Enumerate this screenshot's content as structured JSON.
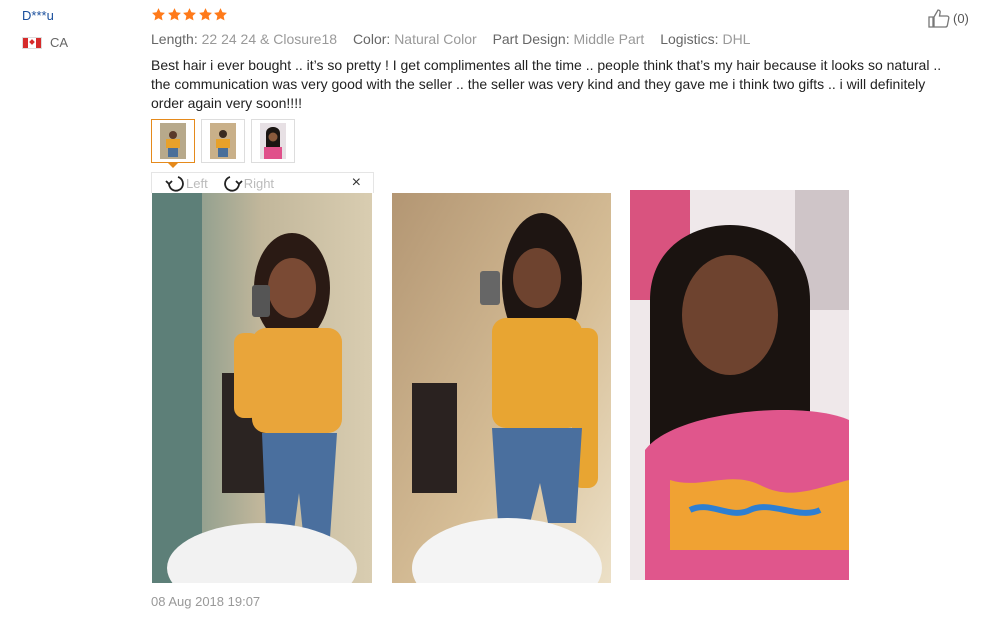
{
  "review": {
    "user": "D***u",
    "country": "CA",
    "rating": 5,
    "attributes": [
      {
        "key": "Length:",
        "value": "22 24 24 & Closure18"
      },
      {
        "key": "Color:",
        "value": "Natural Color"
      },
      {
        "key": "Part Design:",
        "value": "Middle Part"
      },
      {
        "key": "Logistics:",
        "value": "DHL"
      }
    ],
    "text": "Best hair i ever bought .. it’s so pretty ! I get complimentes all the time .. people think that’s my hair because it looks so natural .. the communication was very good with the seller .. the seller was very kind and they gave me i think two gifts .. i will definitely order again very soon!!!!",
    "helpful_count": "(0)",
    "date": "08 Aug 2018 19:07"
  },
  "viewer": {
    "rotate_left": "Left",
    "rotate_right": "Right",
    "close": "×"
  },
  "icons": {
    "star": "star-icon",
    "thumbs_up": "thumbs-up-icon",
    "flag": "canada-flag-icon"
  },
  "colors": {
    "star": "#ff7a1a",
    "username": "#1a4f9c",
    "accent_border": "#e58a1c"
  }
}
